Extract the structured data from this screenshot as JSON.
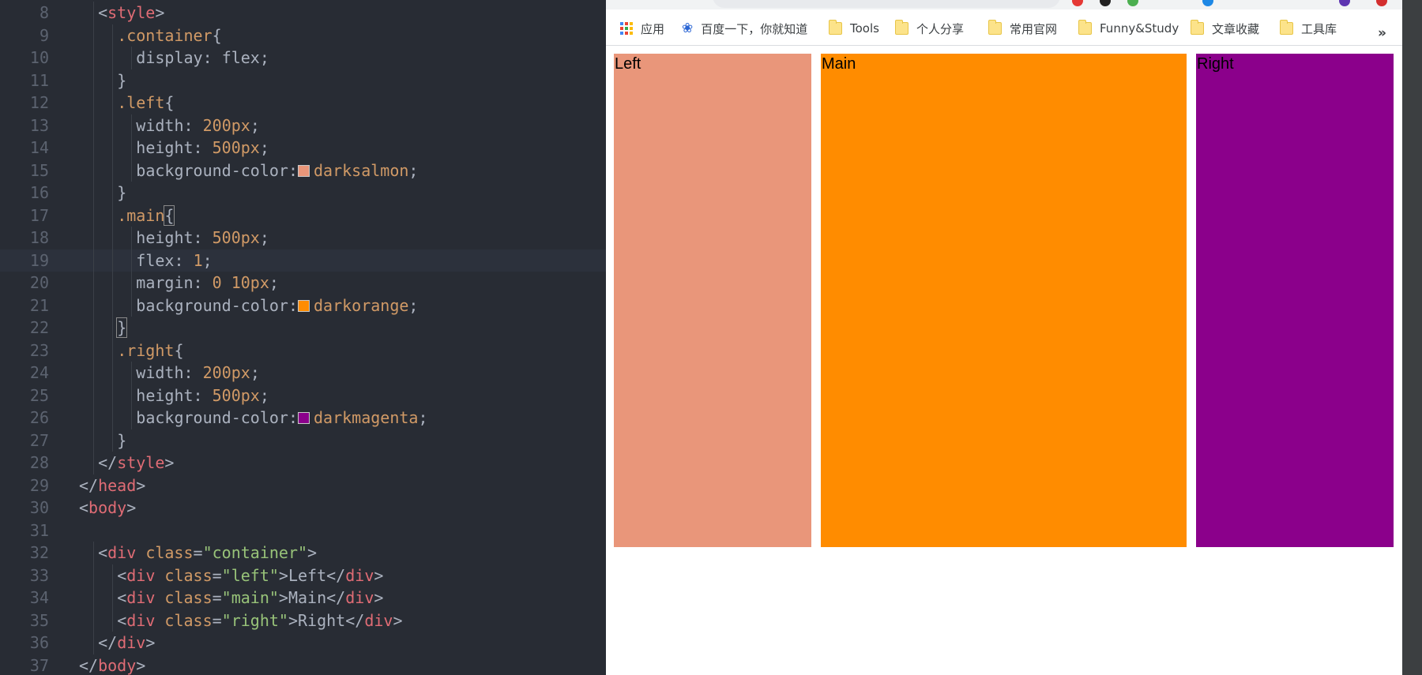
{
  "editor": {
    "lines": [
      {
        "num": "8",
        "indent": 2,
        "tokens": [
          [
            "pun",
            "<"
          ],
          [
            "tag",
            "style"
          ],
          [
            "pun",
            ">"
          ]
        ]
      },
      {
        "num": "9",
        "indent": 4,
        "tokens": [
          [
            "sel",
            ".container"
          ],
          [
            "pun",
            "{"
          ]
        ]
      },
      {
        "num": "10",
        "indent": 6,
        "tokens": [
          [
            "prop",
            "display"
          ],
          [
            "pun",
            ": "
          ],
          [
            "txt",
            "flex"
          ],
          [
            "pun",
            ";"
          ]
        ]
      },
      {
        "num": "11",
        "indent": 4,
        "tokens": [
          [
            "pun",
            "}"
          ]
        ]
      },
      {
        "num": "12",
        "indent": 4,
        "tokens": [
          [
            "sel",
            ".left"
          ],
          [
            "pun",
            "{"
          ]
        ]
      },
      {
        "num": "13",
        "indent": 6,
        "tokens": [
          [
            "prop",
            "width"
          ],
          [
            "pun",
            ": "
          ],
          [
            "num",
            "200px"
          ],
          [
            "pun",
            ";"
          ]
        ]
      },
      {
        "num": "14",
        "indent": 6,
        "tokens": [
          [
            "prop",
            "height"
          ],
          [
            "pun",
            ": "
          ],
          [
            "num",
            "500px"
          ],
          [
            "pun",
            ";"
          ]
        ]
      },
      {
        "num": "15",
        "indent": 6,
        "tokens": [
          [
            "prop",
            "background-color"
          ],
          [
            "pun",
            ":"
          ],
          [
            "swatch",
            "#e9967a"
          ],
          [
            "kw",
            "darksalmon"
          ],
          [
            "pun",
            ";"
          ]
        ]
      },
      {
        "num": "16",
        "indent": 4,
        "tokens": [
          [
            "pun",
            "}"
          ]
        ]
      },
      {
        "num": "17",
        "indent": 4,
        "tokens": [
          [
            "sel",
            ".main"
          ],
          [
            "match",
            "{"
          ]
        ]
      },
      {
        "num": "18",
        "indent": 6,
        "tokens": [
          [
            "prop",
            "height"
          ],
          [
            "pun",
            ": "
          ],
          [
            "num",
            "500px"
          ],
          [
            "pun",
            ";"
          ]
        ]
      },
      {
        "num": "19",
        "indent": 6,
        "tokens": [
          [
            "prop",
            "flex"
          ],
          [
            "pun",
            ": "
          ],
          [
            "num",
            "1"
          ],
          [
            "pun",
            ";"
          ]
        ]
      },
      {
        "num": "20",
        "indent": 6,
        "tokens": [
          [
            "prop",
            "margin"
          ],
          [
            "pun",
            ": "
          ],
          [
            "num",
            "0 10px"
          ],
          [
            "pun",
            ";"
          ]
        ]
      },
      {
        "num": "21",
        "indent": 6,
        "tokens": [
          [
            "prop",
            "background-color"
          ],
          [
            "pun",
            ":"
          ],
          [
            "swatch",
            "#ff8c00"
          ],
          [
            "kw",
            "darkorange"
          ],
          [
            "pun",
            ";"
          ]
        ]
      },
      {
        "num": "22",
        "indent": 4,
        "tokens": [
          [
            "match",
            "}"
          ]
        ]
      },
      {
        "num": "23",
        "indent": 4,
        "tokens": [
          [
            "sel",
            ".right"
          ],
          [
            "pun",
            "{"
          ]
        ]
      },
      {
        "num": "24",
        "indent": 6,
        "tokens": [
          [
            "prop",
            "width"
          ],
          [
            "pun",
            ": "
          ],
          [
            "num",
            "200px"
          ],
          [
            "pun",
            ";"
          ]
        ]
      },
      {
        "num": "25",
        "indent": 6,
        "tokens": [
          [
            "prop",
            "height"
          ],
          [
            "pun",
            ": "
          ],
          [
            "num",
            "500px"
          ],
          [
            "pun",
            ";"
          ]
        ]
      },
      {
        "num": "26",
        "indent": 6,
        "tokens": [
          [
            "prop",
            "background-color"
          ],
          [
            "pun",
            ":"
          ],
          [
            "swatch",
            "#8b008b"
          ],
          [
            "kw",
            "darkmagenta"
          ],
          [
            "pun",
            ";"
          ]
        ]
      },
      {
        "num": "27",
        "indent": 4,
        "tokens": [
          [
            "pun",
            "}"
          ]
        ]
      },
      {
        "num": "28",
        "indent": 2,
        "tokens": [
          [
            "pun",
            "</"
          ],
          [
            "tag",
            "style"
          ],
          [
            "pun",
            ">"
          ]
        ]
      },
      {
        "num": "29",
        "indent": 0,
        "tokens": [
          [
            "pun",
            "</"
          ],
          [
            "tag",
            "head"
          ],
          [
            "pun",
            ">"
          ]
        ]
      },
      {
        "num": "30",
        "indent": 0,
        "tokens": [
          [
            "pun",
            "<"
          ],
          [
            "tag",
            "body"
          ],
          [
            "pun",
            ">"
          ]
        ]
      },
      {
        "num": "31",
        "indent": 0,
        "tokens": []
      },
      {
        "num": "32",
        "indent": 2,
        "tokens": [
          [
            "pun",
            "<"
          ],
          [
            "tag",
            "div"
          ],
          [
            "pun",
            " "
          ],
          [
            "attr",
            "class"
          ],
          [
            "pun",
            "="
          ],
          [
            "str",
            "\"container\""
          ],
          [
            "pun",
            ">"
          ]
        ]
      },
      {
        "num": "33",
        "indent": 4,
        "tokens": [
          [
            "pun",
            "<"
          ],
          [
            "tag",
            "div"
          ],
          [
            "pun",
            " "
          ],
          [
            "attr",
            "class"
          ],
          [
            "pun",
            "="
          ],
          [
            "str",
            "\"left\""
          ],
          [
            "pun",
            ">"
          ],
          [
            "txt",
            "Left"
          ],
          [
            "pun",
            "</"
          ],
          [
            "tag",
            "div"
          ],
          [
            "pun",
            ">"
          ]
        ]
      },
      {
        "num": "34",
        "indent": 4,
        "tokens": [
          [
            "pun",
            "<"
          ],
          [
            "tag",
            "div"
          ],
          [
            "pun",
            " "
          ],
          [
            "attr",
            "class"
          ],
          [
            "pun",
            "="
          ],
          [
            "str",
            "\"main\""
          ],
          [
            "pun",
            ">"
          ],
          [
            "txt",
            "Main"
          ],
          [
            "pun",
            "</"
          ],
          [
            "tag",
            "div"
          ],
          [
            "pun",
            ">"
          ]
        ]
      },
      {
        "num": "35",
        "indent": 4,
        "tokens": [
          [
            "pun",
            "<"
          ],
          [
            "tag",
            "div"
          ],
          [
            "pun",
            " "
          ],
          [
            "attr",
            "class"
          ],
          [
            "pun",
            "="
          ],
          [
            "str",
            "\"right\""
          ],
          [
            "pun",
            ">"
          ],
          [
            "txt",
            "Right"
          ],
          [
            "pun",
            "</"
          ],
          [
            "tag",
            "div"
          ],
          [
            "pun",
            ">"
          ]
        ]
      },
      {
        "num": "36",
        "indent": 2,
        "tokens": [
          [
            "pun",
            "</"
          ],
          [
            "tag",
            "div"
          ],
          [
            "pun",
            ">"
          ]
        ]
      },
      {
        "num": "37",
        "indent": 0,
        "tokens": [
          [
            "pun",
            "</"
          ],
          [
            "tag",
            "body"
          ],
          [
            "pun",
            ">"
          ]
        ]
      }
    ],
    "active_line": "19"
  },
  "browser": {
    "bookmarks": [
      {
        "label": "应用",
        "icon": "apps-icon"
      },
      {
        "label": "百度一下，你就知道",
        "icon": "baidu-paw-icon"
      },
      {
        "label": "Tools",
        "icon": "folder-icon"
      },
      {
        "label": "个人分享",
        "icon": "folder-icon"
      },
      {
        "label": "常用官网",
        "icon": "folder-icon"
      },
      {
        "label": "Funny&Study",
        "icon": "folder-icon"
      },
      {
        "label": "文章收藏",
        "icon": "folder-icon"
      },
      {
        "label": "工具库",
        "icon": "folder-icon"
      }
    ],
    "overflow_label": "»",
    "page": {
      "left_label": "Left",
      "main_label": "Main",
      "right_label": "Right",
      "colors": {
        "left": "#e9967a",
        "main": "#ff8c00",
        "right": "#8b008b"
      }
    }
  }
}
